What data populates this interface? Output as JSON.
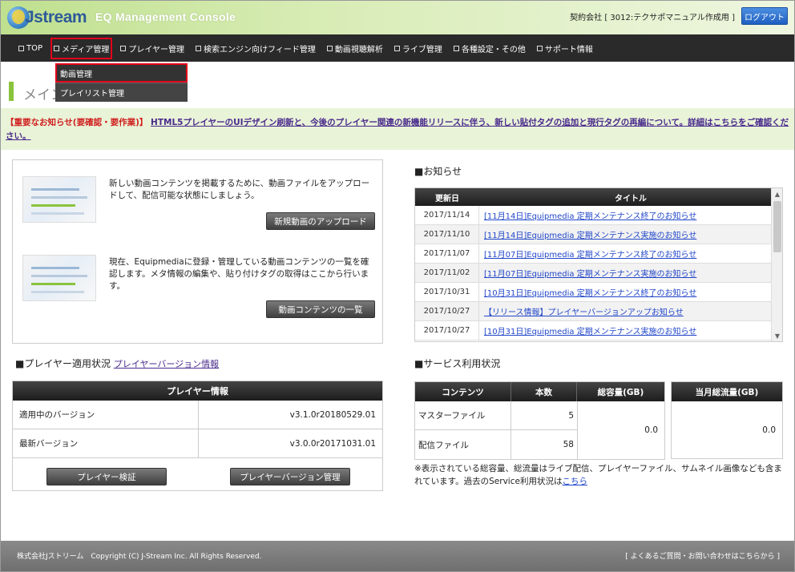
{
  "header": {
    "logo": "Jstream",
    "console_title": "EQ Management Console",
    "contract": "契約会社 [ 3012:テクサポマニュアル作成用 ]",
    "logout": "ログアウト"
  },
  "nav": {
    "items": [
      {
        "label": "TOP"
      },
      {
        "label": "メディア管理"
      },
      {
        "label": "プレイヤー管理"
      },
      {
        "label": "検索エンジン向けフィード管理"
      },
      {
        "label": "動画視聴解析"
      },
      {
        "label": "ライブ管理"
      },
      {
        "label": "各種設定・その他"
      },
      {
        "label": "サポート情報"
      }
    ]
  },
  "dropdown": {
    "items": [
      {
        "label": "動画管理"
      },
      {
        "label": "プレイリスト管理"
      }
    ]
  },
  "page_heading": "メイン",
  "notice": {
    "tag": "【重要なお知らせ(要確認・要作業)】",
    "link": "HTML5プレイヤーのUIデザイン刷新と、今後のプレイヤー関連の新機能リリースに伴う、新しい貼付タグの追加と現行タグの再編について。詳細はこちらをご確認ください。"
  },
  "media": {
    "upload_text": "新しい動画コンテンツを掲載するために、動画ファイルをアップロードして、配信可能な状態にしましょう。",
    "upload_button": "新規動画のアップロード",
    "list_text": "現在、Equipmediaに登録・管理している動画コンテンツの一覧を確認します。メタ情報の編集や、貼り付けタグの取得はここから行います。",
    "list_button": "動画コンテンツの一覧"
  },
  "player": {
    "section_title": "■プレイヤー適用状況",
    "version_link": "プレイヤーバージョン情報",
    "table_head": "プレイヤー情報",
    "rows": [
      {
        "key": "適用中のバージョン",
        "value": "v3.1.0r20180529.01"
      },
      {
        "key": "最新バージョン",
        "value": "v3.0.0r20171031.01"
      }
    ],
    "verify_button": "プレイヤー検証",
    "manage_button": "プレイヤーバージョン管理"
  },
  "news": {
    "section_title": "■お知らせ",
    "col_date": "更新日",
    "col_title": "タイトル",
    "rows": [
      {
        "date": "2017/11/14",
        "title": "[11月14日]Equipmedia 定期メンテナンス終了のお知らせ"
      },
      {
        "date": "2017/11/10",
        "title": "[11月14日]Equipmedia 定期メンテナンス実施のお知らせ"
      },
      {
        "date": "2017/11/07",
        "title": "[11月07日]Equipmedia 定期メンテナンス終了のお知らせ"
      },
      {
        "date": "2017/11/02",
        "title": "[11月07日]Equipmedia 定期メンテナンス実施のお知らせ"
      },
      {
        "date": "2017/10/31",
        "title": "[10月31日]Equipmedia 定期メンテナンス終了のお知らせ"
      },
      {
        "date": "2017/10/27",
        "title": "【リリース情報】プレイヤーバージョンアップお知らせ"
      },
      {
        "date": "2017/10/27",
        "title": "[10月31日]Equipmedia 定期メンテナンス実施のお知らせ"
      }
    ]
  },
  "service": {
    "section_title": "■サービス利用状況",
    "col_contents": "コンテンツ",
    "col_count": "本数",
    "col_total": "総容量(GB)",
    "col_month": "当月総流量(GB)",
    "rows": [
      {
        "name": "マスターファイル",
        "count": "5"
      },
      {
        "name": "配信ファイル",
        "count": "58"
      }
    ],
    "total_value": "0.0",
    "month_value": "0.0",
    "note": "※表示されている総容量、総流量はライブ配信、プレイヤーファイル、サムネイル画像なども含まれています。過去のService利用状況は",
    "note_link": "こちら"
  },
  "footer": {
    "copyright": "株式会社Jストリーム　Copyright (C) J-Stream Inc. All Rights Reserved.",
    "faq": "[ よくあるご質問・お問い合わせはこちらから ]"
  },
  "colors": {
    "header_green": "#bfe08e",
    "nav_bg": "#2a2a2a",
    "highlight_red": "#e2001a",
    "link_blue": "#2247c9"
  }
}
